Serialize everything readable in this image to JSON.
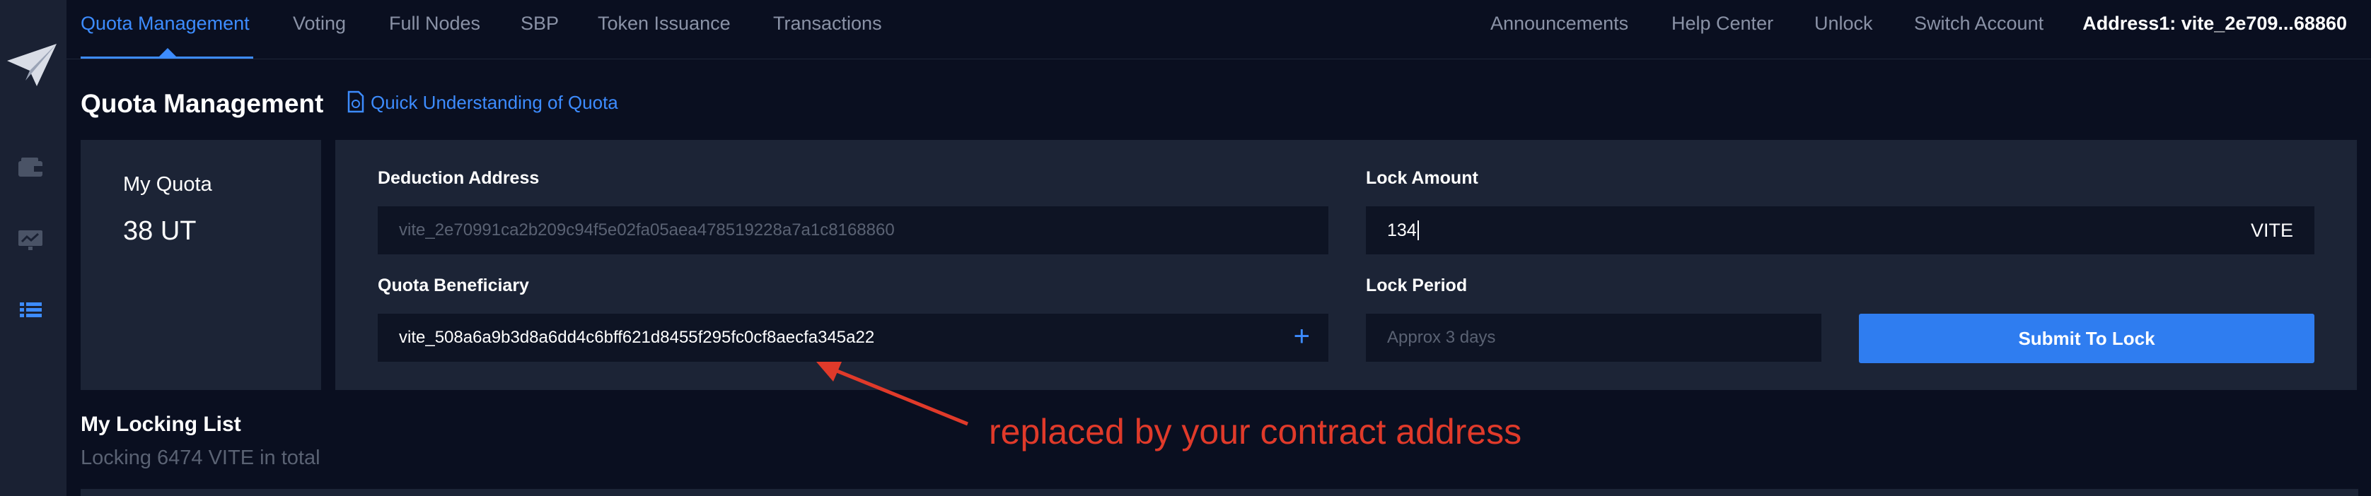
{
  "colors": {
    "accent": "#3d8cff",
    "annotation": "#e03a2a",
    "background": "#0a0f20",
    "panel": "#1c2436"
  },
  "sidebar": {
    "logo_icon": "paper-plane-logo",
    "items": [
      {
        "icon": "wallet-icon"
      },
      {
        "icon": "chart-screen-icon"
      },
      {
        "icon": "list-icon",
        "active": true
      }
    ]
  },
  "nav": {
    "tabs": [
      "Quota Management",
      "Voting",
      "Full Nodes",
      "SBP",
      "Token Issuance",
      "Transactions"
    ],
    "active_tab": "Quota Management",
    "right": [
      "Announcements",
      "Help Center",
      "Unlock",
      "Switch Account"
    ],
    "account": "Address1: vite_2e709...68860"
  },
  "page": {
    "title": "Quota Management",
    "quick_link": "Quick Understanding of Quota"
  },
  "my_quota": {
    "label": "My Quota",
    "value": "38 UT"
  },
  "form": {
    "deduction_label": "Deduction Address",
    "deduction_value": "vite_2e70991ca2b209c94f5e02fa05aea478519228a7a1c8168860",
    "beneficiary_label": "Quota Beneficiary",
    "beneficiary_value": "vite_508a6a9b3d8a6dd4c6bff621d8455f295fc0cf8aecfa345a22",
    "lock_amount_label": "Lock Amount",
    "lock_amount_value": "134",
    "lock_amount_unit": "VITE",
    "lock_period_label": "Lock Period",
    "lock_period_placeholder": "Approx 3 days",
    "submit_label": "Submit To Lock"
  },
  "locking": {
    "title": "My Locking List",
    "summary": "Locking 6474 VITE in total"
  },
  "annotation": {
    "text": "replaced by your contract address"
  }
}
